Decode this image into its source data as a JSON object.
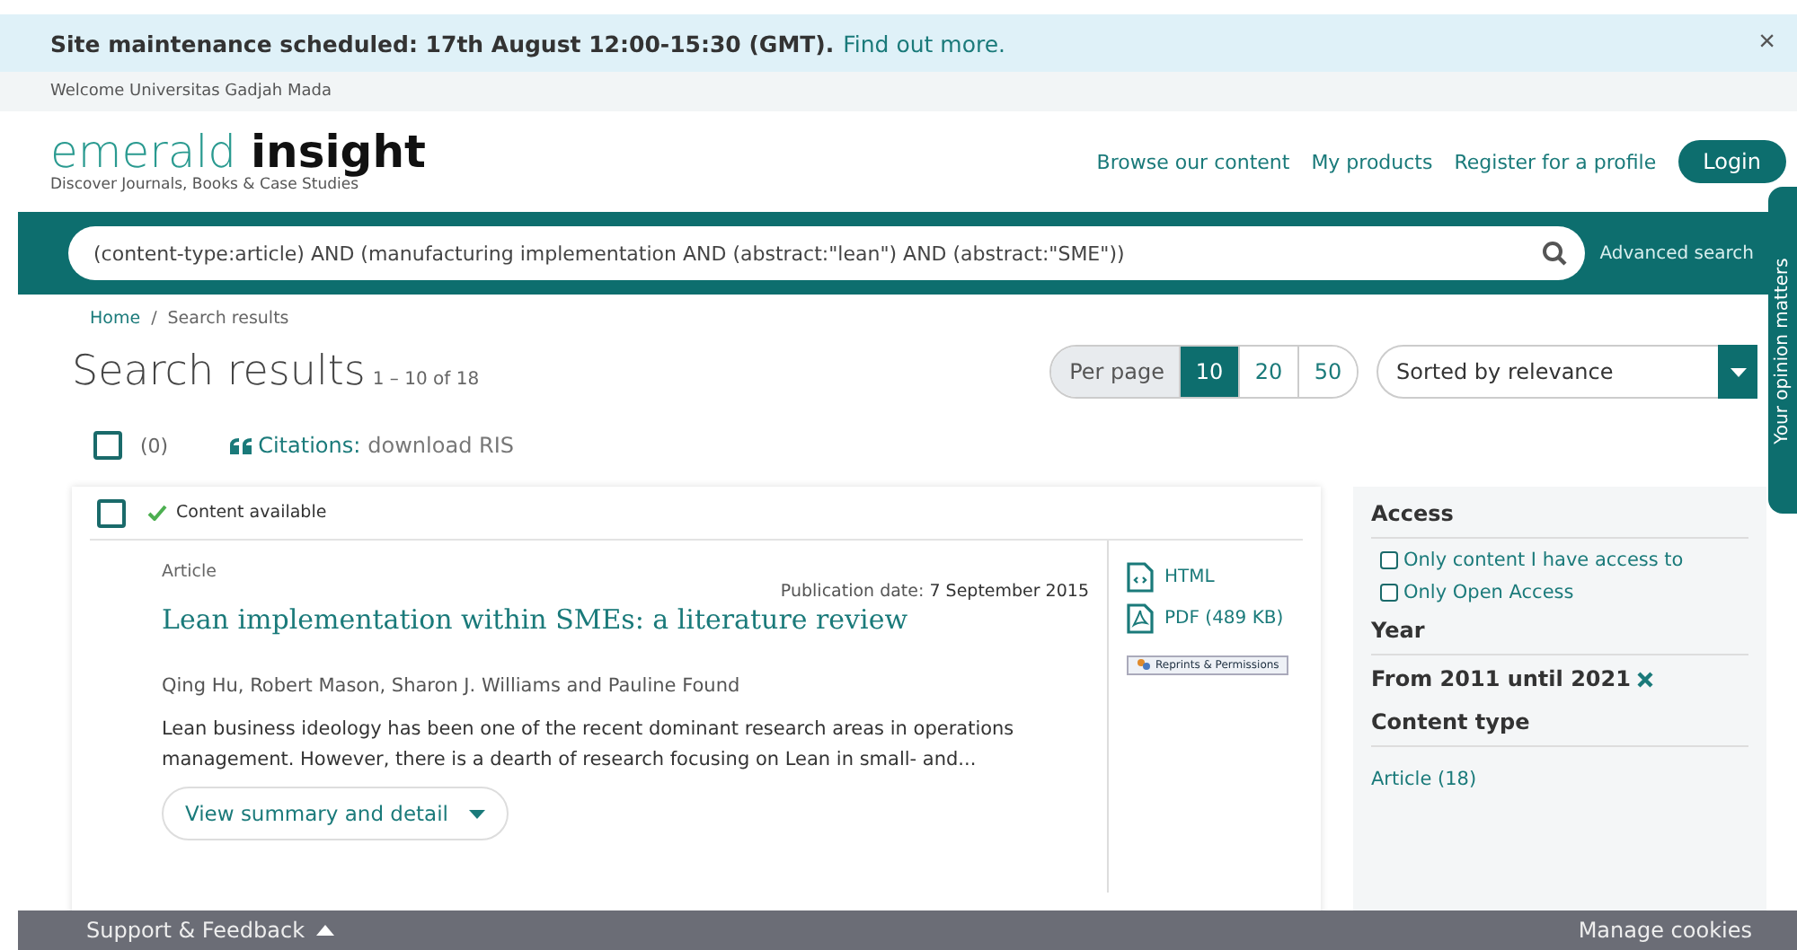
{
  "banner": {
    "text": "Site maintenance scheduled: 17th August 12:00-15:30 (GMT).",
    "link": "Find out more.",
    "close": "×"
  },
  "welcome": "Welcome Universitas Gadjah Mada",
  "logo": {
    "word1": "emerald",
    "word2": "insight",
    "tagline": "Discover Journals, Books & Case Studies"
  },
  "nav": [
    "Browse our content",
    "My products",
    "Register for a profile"
  ],
  "login": "Login",
  "search": {
    "value": "(content-type:article) AND (manufacturing implementation AND (abstract:\"lean\") AND (abstract:\"SME\"))",
    "advanced": "Advanced search"
  },
  "feedback_tab": "Your opinion matters",
  "breadcrumb": [
    "Home",
    "Search results"
  ],
  "breadcrumb_separator": "/",
  "heading": {
    "title": "Search results",
    "range": "1 – 10 of 18"
  },
  "per_page": {
    "label": "Per page",
    "options": [
      {
        "label": "10",
        "selected": true
      },
      {
        "label": "20",
        "selected": false
      },
      {
        "label": "50",
        "selected": false
      }
    ]
  },
  "sort": {
    "value": "Sorted by relevance"
  },
  "select_all": {
    "checked": false,
    "count": "(0)"
  },
  "citations": {
    "label": "Citations:",
    "link": "download RIS"
  },
  "results": [
    {
      "checked": false,
      "availability": "Content available",
      "type": "Article",
      "date_label": "Publication date:",
      "date": "7 September 2015",
      "title": "Lean implementation within SMEs: a literature review",
      "authors": "Qing Hu, Robert Mason, Sharon J. Williams and Pauline Found",
      "abstract": "Lean business ideology has been one of the recent dominant research areas in operations management. However, there is a dearth of research focusing on Lean in small- and...",
      "details_button": "View summary and detail",
      "links": [
        {
          "kind": "html",
          "label": "HTML"
        },
        {
          "kind": "pdf",
          "label": "PDF (489 KB)"
        }
      ],
      "reprints": "Reprints & Permissions"
    }
  ],
  "filters": {
    "access": {
      "title": "Access",
      "options": [
        {
          "label": "Only content I have access to",
          "checked": false
        },
        {
          "label": "Only Open Access",
          "checked": false
        }
      ]
    },
    "year": {
      "title": "Year",
      "value": "From 2011 until 2021"
    },
    "content_type": {
      "title": "Content type",
      "items": [
        "Article (18)"
      ]
    }
  },
  "footer": {
    "support": "Support & Feedback",
    "cookies": "Manage cookies"
  }
}
